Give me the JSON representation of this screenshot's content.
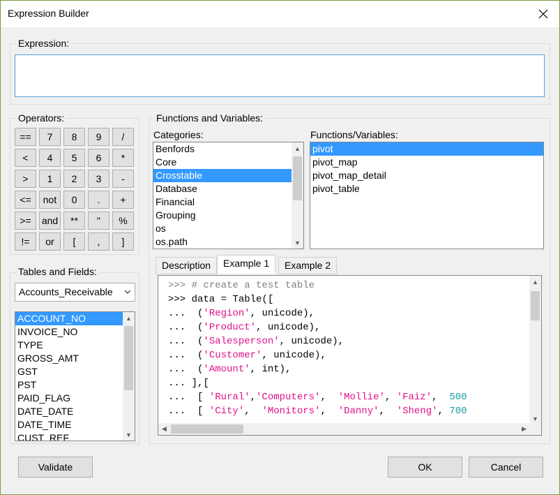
{
  "window": {
    "title": "Expression Builder"
  },
  "expression": {
    "label": "Expression:",
    "value": ""
  },
  "operators": {
    "label": "Operators:",
    "rows": [
      [
        "==",
        "7",
        "8",
        "9",
        "/"
      ],
      [
        "<",
        "4",
        "5",
        "6",
        "*"
      ],
      [
        ">",
        "1",
        "2",
        "3",
        "-"
      ],
      [
        "<=",
        "not",
        "0",
        ".",
        "+"
      ],
      [
        ">=",
        "and",
        "**",
        "\"",
        "%"
      ],
      [
        "!=",
        "or",
        "[",
        ",",
        "]"
      ]
    ]
  },
  "tables": {
    "label": "Tables and Fields:",
    "selected_table": "Accounts_Receivable",
    "fields": [
      "ACCOUNT_NO",
      "INVOICE_NO",
      "TYPE",
      "GROSS_AMT",
      "GST",
      "PST",
      "PAID_FLAG",
      "DATE_DATE",
      "DATE_TIME",
      "CUST_REF"
    ],
    "selected_field": "ACCOUNT_NO"
  },
  "functions": {
    "label": "Functions and Variables:",
    "categories_label": "Categories:",
    "categories": [
      "Benfords",
      "Core",
      "Crosstable",
      "Database",
      "Financial",
      "Grouping",
      "os",
      "os.path"
    ],
    "selected_category": "Crosstable",
    "fv_label": "Functions/Variables:",
    "items": [
      "pivot",
      "pivot_map",
      "pivot_map_detail",
      "pivot_table"
    ],
    "selected_item": "pivot"
  },
  "tabs": [
    "Description",
    "Example 1",
    "Example 2"
  ],
  "active_tab": "Example 1",
  "example_code": [
    [
      [
        "c",
        ">>> "
      ],
      [
        "c",
        "# create a test table"
      ]
    ],
    [
      [
        "t",
        ">>> data = Table(["
      ]
    ],
    [
      [
        "t",
        "...  ("
      ],
      [
        "s",
        "'Region'"
      ],
      [
        "t",
        ", unicode),"
      ]
    ],
    [
      [
        "t",
        "...  ("
      ],
      [
        "s",
        "'Product'"
      ],
      [
        "t",
        ", unicode),"
      ]
    ],
    [
      [
        "t",
        "...  ("
      ],
      [
        "s",
        "'Salesperson'"
      ],
      [
        "t",
        ", unicode),"
      ]
    ],
    [
      [
        "t",
        "...  ("
      ],
      [
        "s",
        "'Customer'"
      ],
      [
        "t",
        ", unicode),"
      ]
    ],
    [
      [
        "t",
        "...  ("
      ],
      [
        "s",
        "'Amount'"
      ],
      [
        "t",
        ", int),"
      ]
    ],
    [
      [
        "t",
        "... ],["
      ]
    ],
    [
      [
        "t",
        "...  [ "
      ],
      [
        "s",
        "'Rural'"
      ],
      [
        "t",
        ","
      ],
      [
        "s",
        "'Computers'"
      ],
      [
        "t",
        ",  "
      ],
      [
        "s",
        "'Mollie'"
      ],
      [
        "t",
        ", "
      ],
      [
        "s",
        "'Faiz'"
      ],
      [
        "t",
        ",  "
      ],
      [
        "n",
        "500"
      ]
    ],
    [
      [
        "t",
        "...  [ "
      ],
      [
        "s",
        "'City'"
      ],
      [
        "t",
        ",  "
      ],
      [
        "s",
        "'Monitors'"
      ],
      [
        "t",
        ",  "
      ],
      [
        "s",
        "'Danny'"
      ],
      [
        "t",
        ",  "
      ],
      [
        "s",
        "'Sheng'"
      ],
      [
        "t",
        ", "
      ],
      [
        "n",
        "700"
      ]
    ]
  ],
  "buttons": {
    "validate": "Validate",
    "ok": "OK",
    "cancel": "Cancel"
  },
  "colors": {
    "selection": "#3399ff",
    "string": "#e0108a",
    "number": "#1c9c9c",
    "comment": "#808080"
  }
}
